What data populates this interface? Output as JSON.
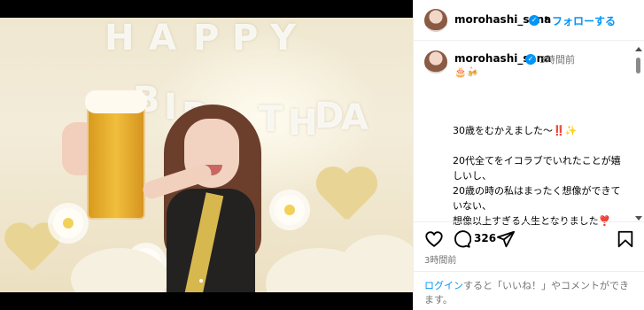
{
  "header": {
    "username": "morohashi_sana",
    "separator": "•",
    "follow_label": "フォローする"
  },
  "caption": {
    "username": "morohashi_sana",
    "time": "3時間前",
    "emoji_line": "🎂🍻",
    "text": "30歳をむかえました〜‼️✨\n\n20代全てをイコラブでいれたことが嬉しいし、\n20歳の時の私はまったく想像ができていない、\n想像以上すぎる人生となりました❣️"
  },
  "photo": {
    "letters": [
      "H",
      "A",
      "P",
      "P",
      "Y",
      "B",
      "I",
      "R",
      "T",
      "H",
      "D",
      "A"
    ]
  },
  "actions": {
    "comment_count": "326",
    "time_ago": "3時間前"
  },
  "login": {
    "link_label": "ログイン",
    "rest_text": "すると「いいね！」やコメントができます。"
  },
  "icons": {
    "like": "heart-icon",
    "comment": "comment-icon",
    "share": "share-icon",
    "save": "bookmark-icon"
  }
}
